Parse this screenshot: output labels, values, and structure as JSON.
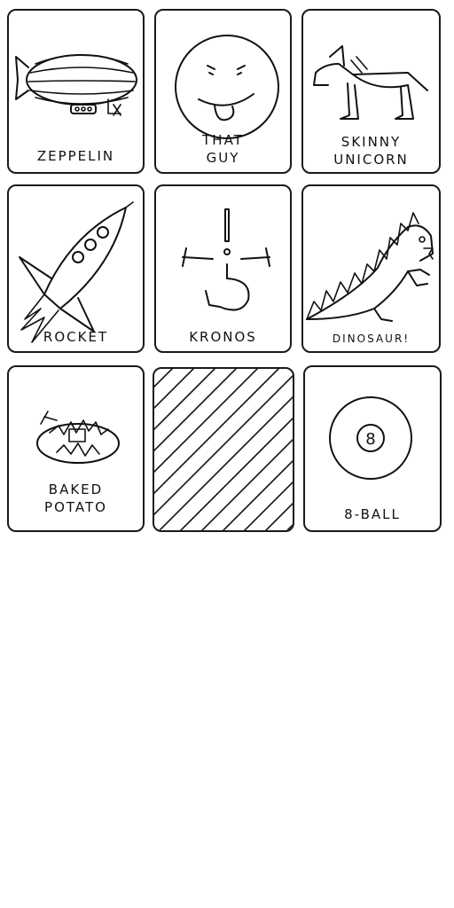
{
  "cards": [
    {
      "label": "ZEPPELIN",
      "icon": "zeppelin-icon"
    },
    {
      "label": "THAT\nGUY",
      "icon": "face-icon"
    },
    {
      "label": "SKINNY\nUNICORN",
      "icon": "unicorn-icon"
    },
    {
      "label": "ROCKET",
      "icon": "rocket-icon"
    },
    {
      "label": "KRONOS",
      "icon": "kronos-symbol-icon"
    },
    {
      "label": "DINOSAUR!",
      "icon": "dinosaur-icon"
    },
    {
      "label": "BAKED\nPOTATO",
      "icon": "potato-icon"
    },
    {
      "label": "",
      "icon": "hatched-blank-icon"
    },
    {
      "label": "8-BALL",
      "icon": "eight-ball-icon"
    }
  ],
  "eight_ball_number": "8"
}
